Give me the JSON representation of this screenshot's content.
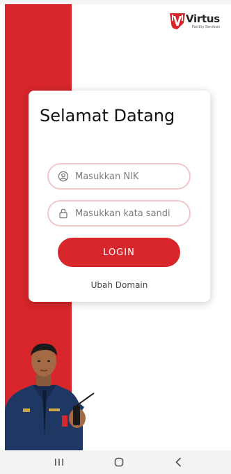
{
  "brand": {
    "name": "Virtus",
    "tagline": "Facility Services",
    "accent_color": "#d7262c"
  },
  "login_card": {
    "greeting": "Selamat Datang",
    "nik_field": {
      "placeholder": "Masukkan NIK",
      "value": "",
      "icon": "user-icon"
    },
    "password_field": {
      "placeholder": "Masukkan kata sandi",
      "value": "",
      "icon": "lock-icon"
    },
    "login_button": "LOGIN",
    "change_domain_link": "Ubah Domain"
  },
  "android_nav": {
    "recent_icon": "recent-apps-icon",
    "home_icon": "home-icon",
    "back_icon": "back-icon"
  }
}
